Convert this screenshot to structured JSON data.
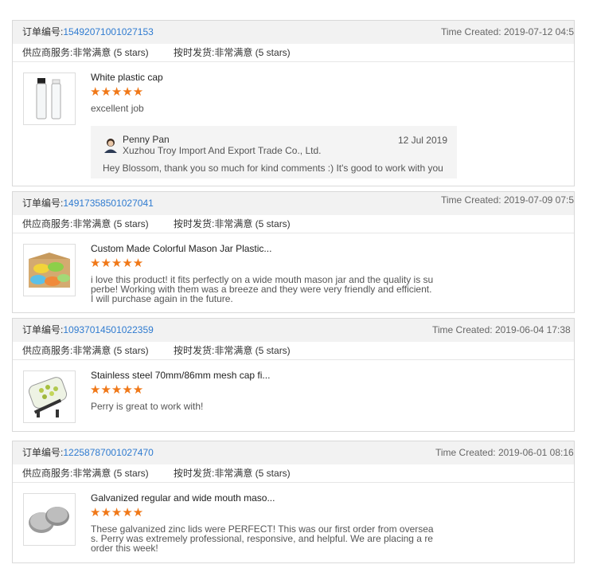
{
  "labels": {
    "order_label": "订单编号:",
    "time_created_label": "Time Created:",
    "supplier_service_label": "供应商服务:",
    "on_time_label": "按时发货:",
    "rating_text": "非常满意 (5 stars)",
    "stars": "★★★★★"
  },
  "colors": {
    "link": "#2f7bd0",
    "star": "#f07818",
    "header_bg": "#f2f2f2"
  },
  "orders": [
    {
      "order_number": "15492071001027153",
      "time_created": "2019-07-12 04:5",
      "product_title": "White plastic cap",
      "comment": "excellent job",
      "thumbnail_icon": "glass-bottles-icon",
      "reply": {
        "name": "Penny Pan",
        "company": "Xuzhou Troy Import And Export Trade Co., Ltd.",
        "date": "12 Jul 2019",
        "text": "Hey Blossom, thank you so much for kind comments :) It's good to work with you"
      }
    },
    {
      "order_number": "14917358501027041",
      "time_created": "2019-07-09 07:5",
      "product_title": "Custom Made Colorful Mason Jar Plastic...",
      "comment": "i love this product! it fits perfectly on a wide mouth mason jar and the quality is superbe! Working with them was a breeze and they were very friendly and efficient. I will purchase again in the future.",
      "thumbnail_icon": "colorful-lids-icon"
    },
    {
      "order_number": "10937014501022359",
      "time_created": "2019-06-04 17:38",
      "product_title": "Stainless steel 70mm/86mm mesh cap fi...",
      "comment": "Perry is great to work with!",
      "thumbnail_icon": "sprouting-jar-icon"
    },
    {
      "order_number": "12258787001027470",
      "time_created": "2019-06-01 08:16",
      "product_title": "Galvanized regular and wide mouth maso...",
      "comment": "These galvanized zinc lids were PERFECT! This was our first order from overseas. Perry was extremely professional, responsive, and helpful. We are placing a reorder this week!",
      "thumbnail_icon": "metal-lids-icon"
    }
  ]
}
